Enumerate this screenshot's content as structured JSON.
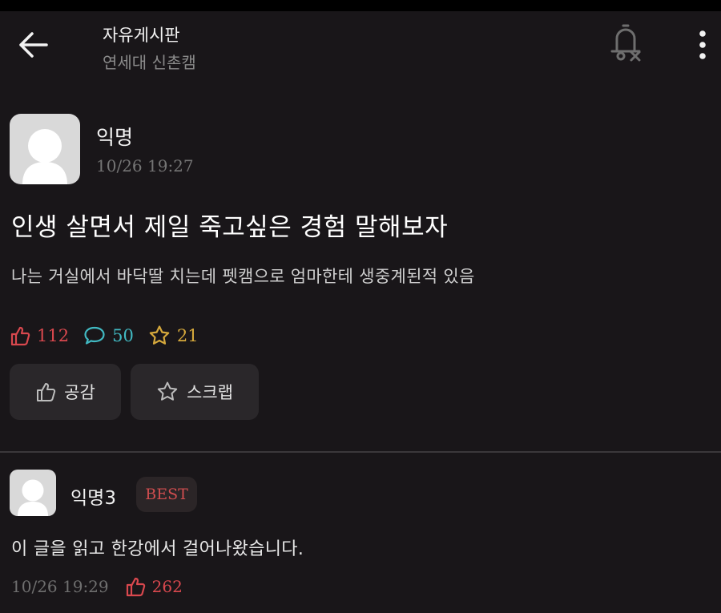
{
  "header": {
    "board_title": "자유게시판",
    "board_subtitle": "연세대 신촌캠",
    "back_icon": "back-arrow-icon",
    "notify_icon": "bell-off-icon",
    "more_icon": "more-vertical-icon"
  },
  "post": {
    "author": "익명",
    "time": "10/26 19:27",
    "title": "인생 살면서 제일 죽고싶은 경험 말해보자",
    "body": "나는 거실에서 바닥딸 치는데 펫캠으로 엄마한테 생중계된적 있음",
    "stats": {
      "likes": "112",
      "comments": "50",
      "scraps": "21"
    },
    "actions": {
      "like_label": "공감",
      "scrap_label": "스크랩"
    }
  },
  "comment": {
    "author": "익명3",
    "badge": "BEST",
    "body": "이 글을 읽고 한강에서 걸어나왔습니다.",
    "time": "10/26 19:29",
    "likes": "262"
  },
  "colors": {
    "background": "#191619",
    "like": "#d9484e",
    "comment": "#41b9c2",
    "scrap": "#d6a93c",
    "button_bg": "#2a272a"
  }
}
